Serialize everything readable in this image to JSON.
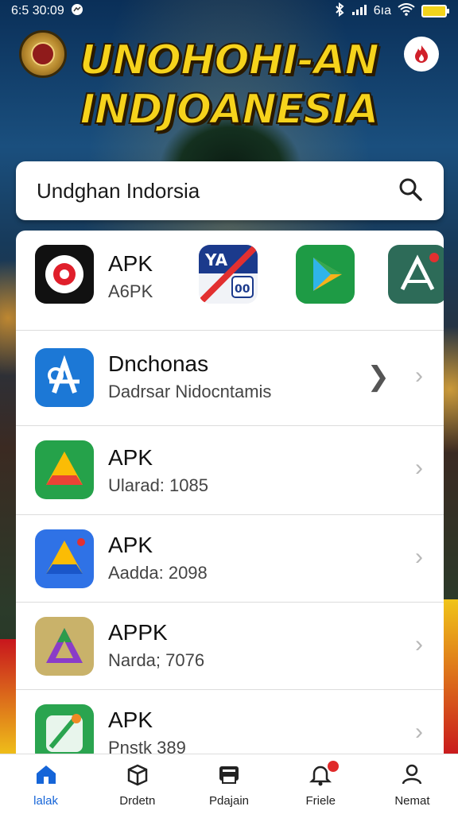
{
  "status_bar": {
    "time": "6:5 30:09",
    "signal_text": "6ıa",
    "icons": [
      "messenger-icon",
      "bluetooth-icon",
      "signal-icon",
      "wifi-icon",
      "battery-icon"
    ]
  },
  "header": {
    "title_line1": "UNOHOHI-AN",
    "title_line2": "INDJOANESIA",
    "title_color": "#f6d31c"
  },
  "search": {
    "value": "Undghan Indorsia",
    "icon": "search-icon"
  },
  "featured": {
    "title": "APK",
    "subtitle": "A6PK",
    "badge_text": "YA",
    "badge_number": "00"
  },
  "list": [
    {
      "title": "Dnchonas",
      "subtitle": "Dadrsar Nidocntamis",
      "icon": "app-store-icon"
    },
    {
      "title": "APK",
      "subtitle": "Ularad: 1085",
      "icon": "drive-icon"
    },
    {
      "title": "APK",
      "subtitle": "Aadda: 2098",
      "icon": "drive-icon"
    },
    {
      "title": "APPK",
      "subtitle": "Narda; 7076",
      "icon": "triangle-icon"
    },
    {
      "title": "APK",
      "subtitle": "Pnstk 389",
      "icon": "pen-icon"
    }
  ],
  "nav": [
    {
      "label": "lalak",
      "icon": "home-icon",
      "active": true
    },
    {
      "label": "Drdetn",
      "icon": "box-icon",
      "active": false
    },
    {
      "label": "Pdajain",
      "icon": "printer-icon",
      "active": false
    },
    {
      "label": "Friele",
      "icon": "bell-icon",
      "active": false
    },
    {
      "label": "Nemat",
      "icon": "profile-icon",
      "active": false
    }
  ],
  "colors": {
    "accent": "#1565d8",
    "title_yellow": "#f6d31c",
    "badge_red": "#e02a2a"
  }
}
